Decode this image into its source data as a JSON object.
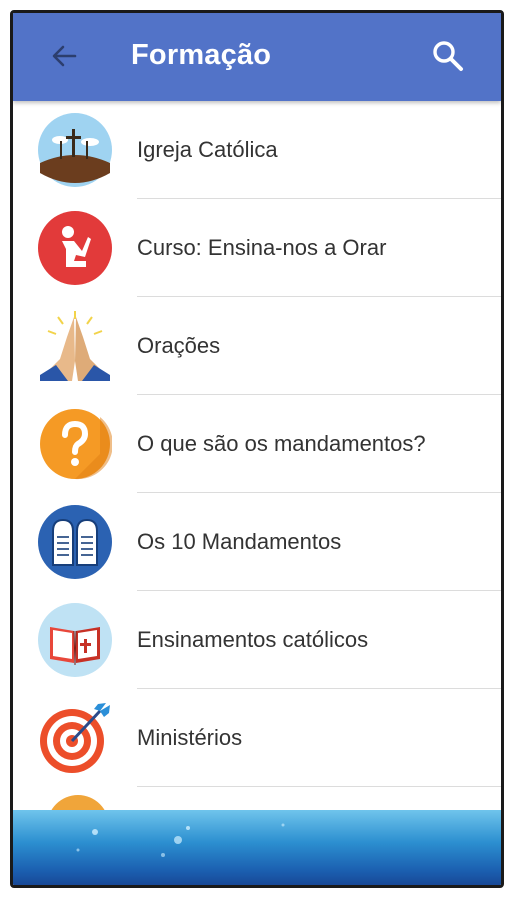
{
  "header": {
    "title": "Formação",
    "back_icon": "arrow-left-icon",
    "search_icon": "search-icon",
    "color": "#5273c8"
  },
  "menu": {
    "items": [
      {
        "label": "Igreja Católica",
        "icon": "calvary-cross-icon"
      },
      {
        "label": "Curso: Ensina-nos a Orar",
        "icon": "kneeling-prayer-icon"
      },
      {
        "label": "Orações",
        "icon": "praying-hands-icon"
      },
      {
        "label": "O que são os mandamentos?",
        "icon": "question-mark-icon"
      },
      {
        "label": "Os 10 Mandamentos",
        "icon": "stone-tablets-icon"
      },
      {
        "label": "Ensinamentos católicos",
        "icon": "bible-book-icon"
      },
      {
        "label": "Ministérios",
        "icon": "target-arrow-icon"
      }
    ]
  },
  "footer": {
    "banner": "water-banner"
  }
}
